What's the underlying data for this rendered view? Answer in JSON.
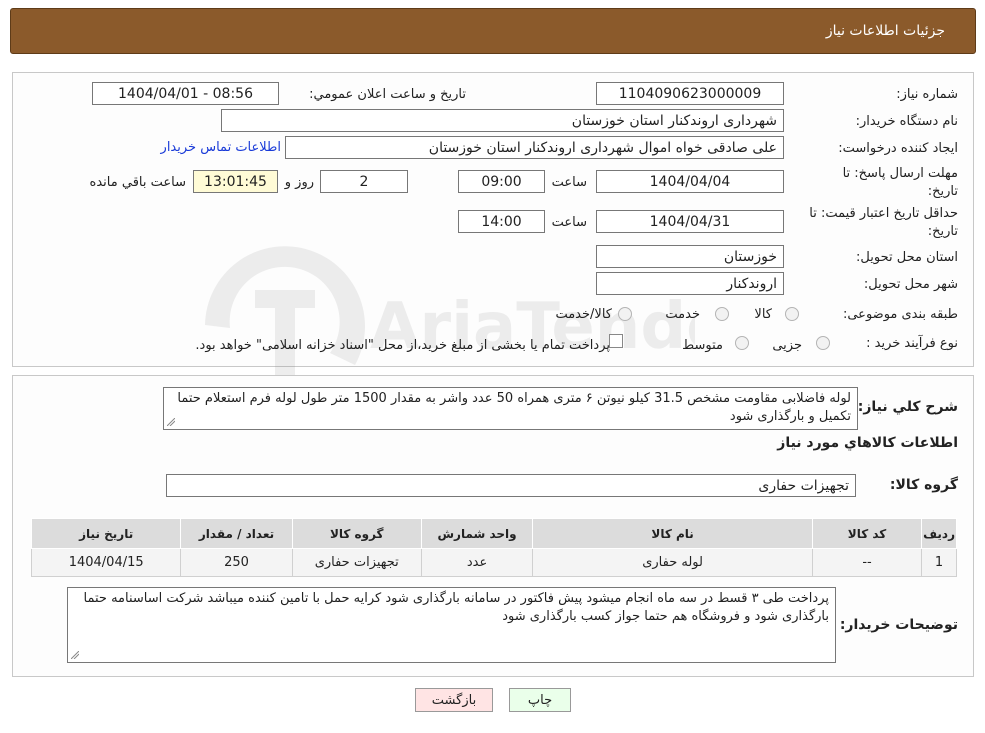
{
  "header": {
    "title": "جزئیات اطلاعات نیاز"
  },
  "form": {
    "need_number_label": "شماره نیاز:",
    "need_number": "1104090623000009",
    "announce_label": "تاریخ و ساعت اعلان عمومي:",
    "announce_value": "1404/04/01 - 08:56",
    "buyer_org_label": "نام دستگاه خریدار:",
    "buyer_org": "شهرداری اروندکنار استان خوزستان",
    "creator_label": "ایجاد کننده درخواست:",
    "creator": "علی صادقی خواه اموال شهرداری اروندکنار استان خوزستان",
    "contact_link": "اطلاعات تماس خریدار",
    "deadline_label": "مهلت ارسال پاسخ: تا تاریخ:",
    "deadline_date": "1404/04/04",
    "time_label": "ساعت",
    "deadline_time": "09:00",
    "days_value": "2",
    "days_label": "روز و",
    "remaining_time": "13:01:45",
    "remaining_label": "ساعت باقي مانده",
    "validity_label": "حداقل تاریخ اعتبار قیمت: تا تاریخ:",
    "validity_date": "1404/04/31",
    "validity_time": "14:00",
    "province_label": "استان محل تحویل:",
    "province": "خوزستان",
    "city_label": "شهر محل تحویل:",
    "city": "اروندکنار",
    "category_label": "طبقه بندی موضوعی:",
    "category_options": [
      "کالا",
      "خدمت",
      "کالا/خدمت"
    ],
    "process_label": "نوع فرآیند خرید :",
    "process_options": [
      "جزیی",
      "متوسط"
    ],
    "process_note": "پرداخت تمام یا بخشی از مبلغ خرید،از محل \"اسناد خزانه اسلامی\" خواهد بود."
  },
  "details": {
    "summary_label": "شرح کلي نياز:",
    "summary": "لوله فاضلابی مقاومت مشخص 31.5 کیلو نیوتن ۶ متری همراه 50 عدد واشر به مقدار 1500 متر طول لوله فرم استعلام حتما تکمیل و بارگذاری شود",
    "goods_section_title": "اطلاعات کالاهاي مورد نياز",
    "group_label": "گروه کالا:",
    "group_value": "تجهیزات حفاری",
    "table": {
      "headers": [
        "ردیف",
        "کد کالا",
        "نام کالا",
        "واحد شمارش",
        "گروه کالا",
        "تعداد / مقدار",
        "تاریخ نیاز"
      ],
      "rows": [
        [
          "1",
          "--",
          "لوله حفاری",
          "عدد",
          "تجهیزات حفاری",
          "250",
          "1404/04/15"
        ]
      ]
    },
    "buyer_notes_label": "توضیحات خریدار:",
    "buyer_notes": "پرداخت طی ۳ قسط در سه ماه انجام میشود پیش فاکتور در سامانه بارگذاری شود  کرایه حمل با تامین کننده میباشد شرکت اساسنامه حتما بارگذاری شود و فروشگاه هم حتما جواز کسب بارگذاری شود"
  },
  "buttons": {
    "print": "چاپ",
    "back": "بازگشت"
  },
  "colors": {
    "header_bg": "#8b5a2b",
    "link": "#1a3bd8",
    "print_btn": "#eaffea",
    "back_btn": "#ffe4e4"
  },
  "watermark": {
    "text": "AriaTender.net"
  }
}
